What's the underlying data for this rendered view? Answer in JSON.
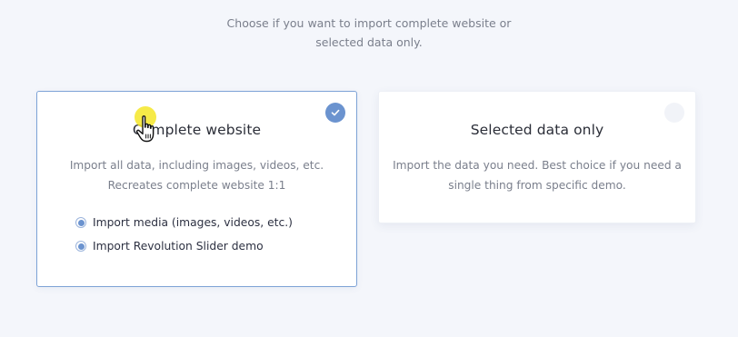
{
  "intro": {
    "line1": "Choose if you want to import complete website or",
    "line2": "selected data only."
  },
  "cards": {
    "complete": {
      "title": "Complete website",
      "selected": true,
      "desc_line1": "Import all data, including images, videos, etc.",
      "desc_line2": "Recreates complete website 1:1",
      "options": [
        {
          "label": "Import media (images, videos, etc.)",
          "checked": true
        },
        {
          "label": "Import Revolution Slider demo",
          "checked": true
        }
      ]
    },
    "selected_data": {
      "title": "Selected data only",
      "selected": false,
      "desc_line1": "Import the data you need. Best choice if you need a",
      "desc_line2": "single thing from specific demo."
    }
  },
  "colors": {
    "accent": "#6b93cf",
    "selected_border": "#7da2d6",
    "background": "#f4f6fb",
    "cursor_highlight": "#f5e628"
  },
  "icons": {
    "check": "check-icon",
    "cursor": "hand-pointer-icon"
  }
}
